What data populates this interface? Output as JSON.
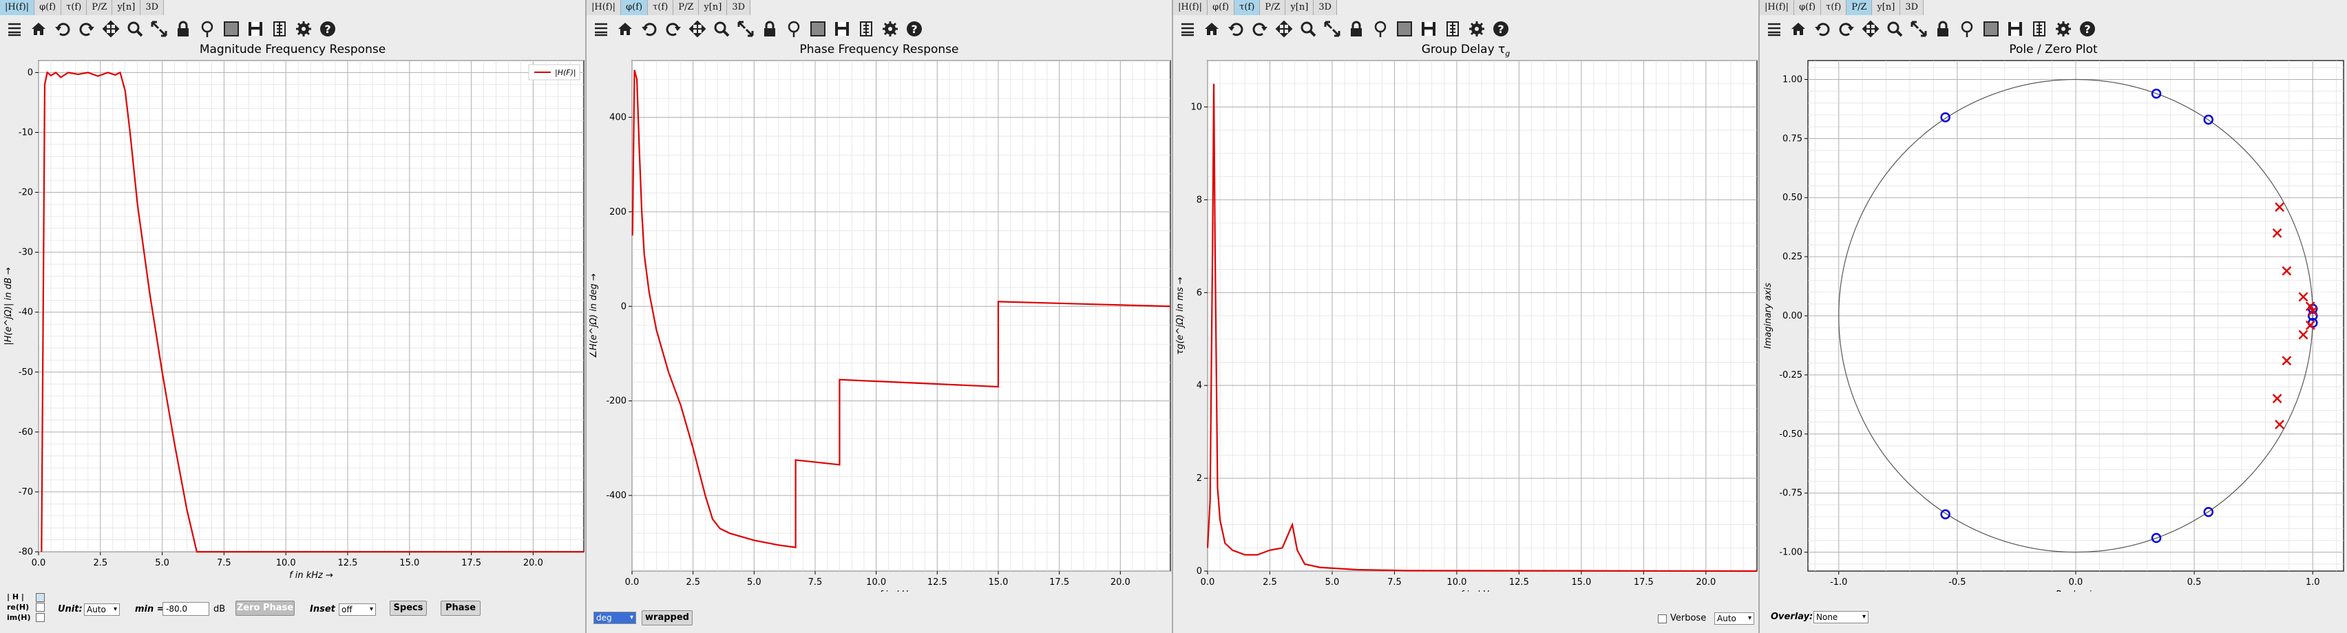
{
  "tabs": [
    "|H(f)|",
    "φ(f)",
    "τ(f)",
    "P/Z",
    "y[n]",
    "3D"
  ],
  "active_tabs": [
    0,
    1,
    2,
    3
  ],
  "toolbar_icons": [
    "menu-icon",
    "home-icon",
    "undo-icon",
    "redo-icon",
    "pan-icon",
    "zoom-icon",
    "zoom-full-icon",
    "lock-icon",
    "marker-icon",
    "grid-icon",
    "save-icon",
    "csv-icon",
    "settings-icon",
    "help-icon"
  ],
  "colors": {
    "trace": "#e00000",
    "zero": "#0000dd",
    "pole": "#e00000",
    "grid": "#b0b0b0",
    "plot_bg": "#ffffff",
    "tab_active": "#a9d4ea"
  },
  "mag": {
    "title": "Magnitude Frequency Response",
    "ylabel": "|H(e^jΩ)| in dB →",
    "xlabel": "f in kHz →",
    "legend": "|H(F)|",
    "controls": {
      "h_label": "| H |",
      "re_label": "re(H)",
      "im_label": "im(H)",
      "unit_label": "Unit:",
      "unit_value": "Auto",
      "min_label": "min",
      "min_eq": "=",
      "min_value": "-80.0",
      "min_unit": "dB",
      "zero_phase": "Zero Phase",
      "inset_label": "Inset",
      "inset_value": "off",
      "specs": "Specs",
      "phase": "Phase"
    }
  },
  "phase": {
    "title": "Phase Frequency Response",
    "ylabel": "∠H(e^jΩ) in deg →",
    "xlabel": "f in kHz →",
    "controls": {
      "unit_value": "deg",
      "wrapped": "wrapped"
    }
  },
  "delay": {
    "title": "Group Delay τ",
    "title_sub": "g",
    "ylabel": "τg(e^jΩ) in ms →",
    "xlabel": "f in kHz →",
    "controls": {
      "verbose": "Verbose",
      "verbose_value": "Auto"
    }
  },
  "pz": {
    "title": "Pole / Zero Plot",
    "ylabel": "Imaginary axis",
    "xlabel": "Real axis",
    "controls": {
      "overlay_label": "Overlay:",
      "overlay_value": "None"
    }
  },
  "chart_data": [
    {
      "type": "line",
      "title": "Magnitude Frequency Response",
      "xlabel": "f in kHz →",
      "ylabel": "|H(e^jΩ)| in dB →",
      "xlim": [
        0,
        22.05
      ],
      "ylim": [
        -80,
        2
      ],
      "xticks": [
        "0.0",
        "2.5",
        "5.0",
        "7.5",
        "10.0",
        "12.5",
        "15.0",
        "17.5",
        "20.0"
      ],
      "yticks": [
        "0",
        "-10",
        "-20",
        "-30",
        "-40",
        "-50",
        "-60",
        "-70",
        "-80"
      ],
      "series": [
        {
          "name": "|H(F)|",
          "x": [
            0.12,
            0.25,
            0.35,
            0.5,
            0.7,
            0.9,
            1.2,
            1.6,
            2.0,
            2.4,
            2.8,
            3.1,
            3.3,
            3.5,
            3.7,
            4.0,
            4.5,
            5.0,
            5.5,
            6.0,
            6.4,
            22.05
          ],
          "y": [
            -80,
            -2,
            0,
            -0.5,
            0,
            -0.8,
            0,
            -0.3,
            0,
            -0.6,
            0,
            -0.4,
            0,
            -3,
            -10,
            -22,
            -37,
            -50,
            -62,
            -73,
            -80,
            -80
          ]
        }
      ]
    },
    {
      "type": "line",
      "title": "Phase Frequency Response",
      "xlabel": "f in kHz →",
      "ylabel": "∠H(e^jΩ) in deg →",
      "xlim": [
        0,
        22.05
      ],
      "ylim": [
        -560,
        520
      ],
      "xticks": [
        "0.0",
        "2.5",
        "5.0",
        "7.5",
        "10.0",
        "12.5",
        "15.0",
        "17.5",
        "20.0"
      ],
      "yticks": [
        "400",
        "200",
        "0",
        "-200",
        "-400"
      ],
      "series": [
        {
          "name": "",
          "x": [
            0.02,
            0.1,
            0.2,
            0.3,
            0.4,
            0.5,
            0.7,
            1.0,
            1.5,
            2.0,
            2.5,
            3.0,
            3.3,
            3.6,
            4.0,
            5.0,
            6.0,
            6.7,
            6.7,
            8.5,
            8.5,
            15.0,
            15.0,
            22.05
          ],
          "y": [
            150,
            500,
            480,
            330,
            200,
            110,
            30,
            -50,
            -140,
            -210,
            -300,
            -400,
            -450,
            -470,
            -480,
            -495,
            -505,
            -510,
            -325,
            -335,
            -155,
            -170,
            10,
            0
          ]
        }
      ]
    },
    {
      "type": "line",
      "title": "Group Delay τg",
      "xlabel": "f in kHz →",
      "ylabel": "τg(e^jΩ) in ms →",
      "xlim": [
        0,
        22.05
      ],
      "ylim": [
        0,
        11
      ],
      "xticks": [
        "0.0",
        "2.5",
        "5.0",
        "7.5",
        "10.0",
        "12.5",
        "15.0",
        "17.5",
        "20.0"
      ],
      "yticks": [
        "0",
        "2",
        "4",
        "6",
        "8",
        "10"
      ],
      "series": [
        {
          "name": "",
          "x": [
            0,
            0.1,
            0.2,
            0.25,
            0.3,
            0.4,
            0.5,
            0.7,
            1.0,
            1.5,
            2.0,
            2.5,
            3.0,
            3.2,
            3.4,
            3.6,
            3.9,
            4.5,
            6.0,
            8.0,
            22.05
          ],
          "y": [
            0.5,
            1.5,
            7,
            10.5,
            7,
            1.8,
            1.1,
            0.6,
            0.45,
            0.35,
            0.35,
            0.45,
            0.5,
            0.75,
            1.0,
            0.45,
            0.15,
            0.08,
            0.03,
            0.01,
            0
          ]
        }
      ]
    },
    {
      "type": "scatter",
      "title": "Pole / Zero Plot",
      "xlabel": "Real axis",
      "ylabel": "Imaginary axis",
      "xlim": [
        -1.13,
        1.13
      ],
      "ylim": [
        -1.08,
        1.08
      ],
      "xticks": [
        "-1.0",
        "-0.5",
        "0.0",
        "0.5",
        "1.0"
      ],
      "yticks": [
        "1.00",
        "0.75",
        "0.50",
        "0.25",
        "0.00",
        "-0.25",
        "-0.50",
        "-0.75",
        "-1.00"
      ],
      "zeros": [
        [
          -0.55,
          0.84
        ],
        [
          0.34,
          0.94
        ],
        [
          0.56,
          0.83
        ],
        [
          -0.55,
          -0.84
        ],
        [
          0.34,
          -0.94
        ],
        [
          0.56,
          -0.83
        ],
        [
          1.0,
          0.03
        ],
        [
          1.0,
          0.0
        ],
        [
          1.0,
          -0.03
        ]
      ],
      "poles": [
        [
          0.86,
          0.46
        ],
        [
          0.85,
          0.35
        ],
        [
          0.89,
          0.19
        ],
        [
          0.96,
          0.08
        ],
        [
          0.99,
          0.04
        ],
        [
          1.0,
          0.02
        ],
        [
          0.99,
          -0.04
        ],
        [
          0.96,
          -0.08
        ],
        [
          0.89,
          -0.19
        ],
        [
          0.85,
          -0.35
        ],
        [
          0.86,
          -0.46
        ]
      ]
    }
  ]
}
